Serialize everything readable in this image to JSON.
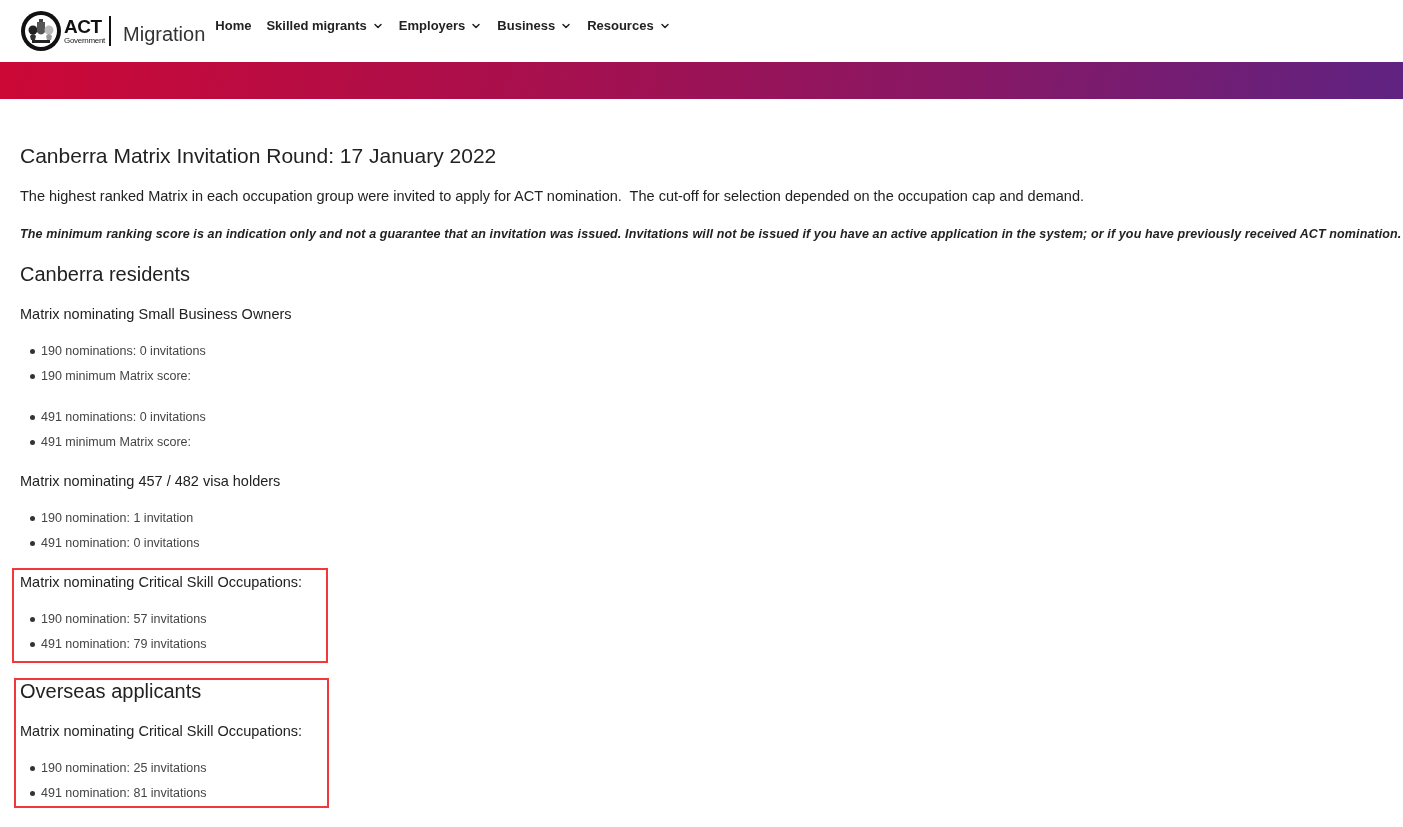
{
  "header": {
    "logo": {
      "wordmark": "ACT",
      "subtitle": "Government"
    },
    "site_name": "Migration",
    "nav": [
      {
        "label": "Home",
        "has_dropdown": false
      },
      {
        "label": "Skilled migrants",
        "has_dropdown": true
      },
      {
        "label": "Employers",
        "has_dropdown": true
      },
      {
        "label": "Business",
        "has_dropdown": true
      },
      {
        "label": "Resources",
        "has_dropdown": true
      }
    ]
  },
  "page": {
    "title": "Canberra Matrix Invitation Round: 17 January 2022",
    "intro": "The highest ranked Matrix in each occupation group were invited to apply for ACT nomination.  The cut-off for selection depended on the occupation cap and demand.",
    "disclaimer": "The minimum ranking score is an indication only and not a guarantee that an invitation was issued. Invitations will not be issued if you have an active application in the system; or if you have previously received ACT nomination.",
    "sections": [
      {
        "heading": "Canberra residents",
        "highlighted": false,
        "groups": [
          {
            "label": "Matrix nominating Small Business Owners",
            "highlighted": false,
            "lists": [
              {
                "items": [
                  "190 nominations: 0 invitations",
                  "190 minimum Matrix score:"
                ]
              },
              {
                "items": [
                  "491 nominations: 0 invitations",
                  "491 minimum Matrix score:"
                ]
              }
            ]
          },
          {
            "label": "Matrix nominating 457 / 482 visa holders",
            "highlighted": false,
            "lists": [
              {
                "items": [
                  "190 nomination: 1 invitation",
                  "491 nomination: 0 invitations"
                ]
              }
            ]
          },
          {
            "label": "Matrix nominating Critical Skill Occupations:",
            "highlighted": true,
            "lists": [
              {
                "items": [
                  "190 nomination: 57 invitations",
                  "491 nomination: 79 invitations"
                ]
              }
            ]
          }
        ]
      },
      {
        "heading": "Overseas applicants",
        "highlighted": true,
        "groups": [
          {
            "label": "Matrix nominating Critical Skill Occupations:",
            "highlighted": false,
            "lists": [
              {
                "items": [
                  "190 nomination: 25 invitations",
                  "491 nomination: 81 invitations"
                ]
              }
            ]
          }
        ]
      }
    ]
  }
}
